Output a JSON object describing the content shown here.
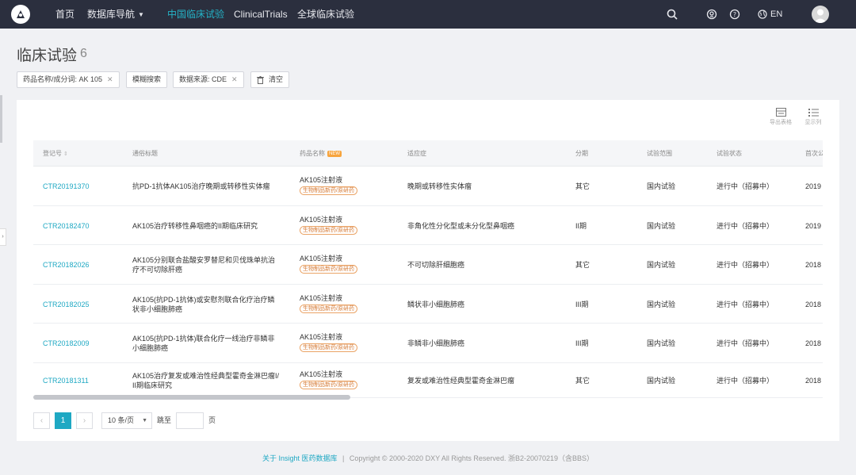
{
  "nav": {
    "home": "首页",
    "database_nav": "数据库导航",
    "cn_trials": "中国临床试验",
    "clinical_trials": "ClinicalTrials",
    "global_trials": "全球临床试验",
    "lang": "EN"
  },
  "page": {
    "title": "临床试验",
    "count": "6"
  },
  "filters": {
    "drug": "药品名称/成分词: AK 105",
    "fuzzy": "模糊搜索",
    "source": "数据来源: CDE",
    "clear": "清空"
  },
  "tools": {
    "export": "导出表格",
    "columns": "显示列"
  },
  "table": {
    "headers": [
      "登记号",
      "通俗标题",
      "药品名称",
      "适应症",
      "分期",
      "试验范围",
      "试验状态",
      "首次公"
    ],
    "new_badge": "NEW",
    "rows": [
      {
        "id": "CTR20191370",
        "title": [
          "抗PD-1抗体AK105治疗晚期或转移性实体瘤"
        ],
        "drug": "AK105注射液",
        "tag": "生物制品新药/原研药",
        "indication": "晚期或转移性实体瘤",
        "phase": "其它",
        "scope": "国内试验",
        "status": "进行中（招募中）",
        "date": "2019"
      },
      {
        "id": "CTR20182470",
        "title": [
          "AK105治疗转移性鼻咽癌的II期临床研究"
        ],
        "drug": "AK105注射液",
        "tag": "生物制品新药/原研药",
        "indication": "非角化性分化型或未分化型鼻咽癌",
        "phase": "II期",
        "scope": "国内试验",
        "status": "进行中（招募中）",
        "date": "2019"
      },
      {
        "id": "CTR20182026",
        "title": [
          "AK105分别联合盐酸安罗替尼和贝伐珠单抗治",
          "疗不可切除肝癌"
        ],
        "drug": "AK105注射液",
        "tag": "生物制品新药/原研药",
        "indication": "不可切除肝细胞癌",
        "phase": "其它",
        "scope": "国内试验",
        "status": "进行中（招募中）",
        "date": "2018"
      },
      {
        "id": "CTR20182025",
        "title": [
          "AK105(抗PD-1抗体)或安慰剂联合化疗治疗鳞",
          "状非小细胞肺癌"
        ],
        "drug": "AK105注射液",
        "tag": "生物制品新药/原研药",
        "indication": "鳞状非小细胞肺癌",
        "phase": "III期",
        "scope": "国内试验",
        "status": "进行中（招募中）",
        "date": "2018"
      },
      {
        "id": "CTR20182009",
        "title": [
          "AK105(抗PD-1抗体)联合化疗一线治疗非鳞非",
          "小细胞肺癌"
        ],
        "drug": "AK105注射液",
        "tag": "生物制品新药/原研药",
        "indication": "非鳞非小细胞肺癌",
        "phase": "III期",
        "scope": "国内试验",
        "status": "进行中（招募中）",
        "date": "2018"
      },
      {
        "id": "CTR20181311",
        "title": [
          "AK105治疗复发或难治性经典型霍奇金淋巴瘤I/",
          "II期临床研究"
        ],
        "drug": "AK105注射液",
        "tag": "生物制品新药/原研药",
        "indication": "复发或难治性经典型霍奇金淋巴瘤",
        "phase": "其它",
        "scope": "国内试验",
        "status": "进行中（招募中）",
        "date": "2018"
      }
    ]
  },
  "pagination": {
    "prev": "‹",
    "current": "1",
    "next": "›",
    "page_size": "10 条/页",
    "goto": "跳至",
    "page_unit": "页"
  },
  "footer": {
    "link": "关于 Insight 医药数据库",
    "sep": "|",
    "copyright": "Copyright © 2000-2020 DXY All Rights Reserved. 浙B2-20070219（含BBS）"
  },
  "colors": {
    "nav_bg": "#2b2f3e",
    "accent": "#1ea8c3",
    "active_nav": "#24b3c7",
    "tag": "#d57a35",
    "new_badge": "#f7a43d"
  }
}
